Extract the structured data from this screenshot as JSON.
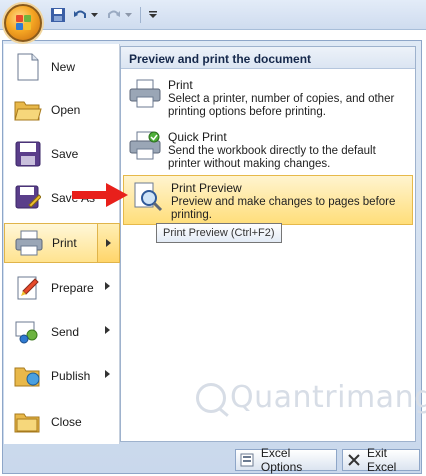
{
  "menu": {
    "items": [
      {
        "label": "New",
        "icon": "new-document-icon"
      },
      {
        "label": "Open",
        "icon": "open-folder-icon"
      },
      {
        "label": "Save",
        "icon": "save-disk-icon"
      },
      {
        "label": "Save As",
        "icon": "save-as-icon"
      },
      {
        "label": "Print",
        "icon": "printer-icon"
      },
      {
        "label": "Prepare",
        "icon": "prepare-icon"
      },
      {
        "label": "Send",
        "icon": "send-icon"
      },
      {
        "label": "Publish",
        "icon": "publish-icon"
      },
      {
        "label": "Close",
        "icon": "close-folder-icon"
      }
    ]
  },
  "panel": {
    "header": "Preview and print the document",
    "options": [
      {
        "title": "Print",
        "description": "Select a printer, number of copies, and other printing options before printing."
      },
      {
        "title": "Quick Print",
        "description": "Send the workbook directly to the default printer without making changes."
      },
      {
        "title": "Print Preview",
        "description": "Preview and make changes to pages before printing."
      }
    ]
  },
  "tooltip": "Print Preview (Ctrl+F2)",
  "bottom": {
    "options_label": "Excel Options",
    "exit_label": "Exit Excel"
  },
  "watermark": "Quantrimang",
  "colors": {
    "highlight": "#ffe38f",
    "accent_border": "#e0b44a",
    "arrow": "#e8201b",
    "frame": "#c9d8ec"
  }
}
